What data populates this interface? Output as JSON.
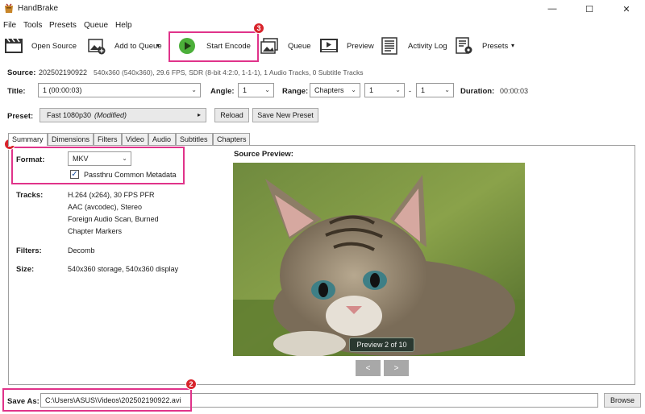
{
  "window": {
    "title": "HandBrake"
  },
  "menu": [
    "File",
    "Tools",
    "Presets",
    "Queue",
    "Help"
  ],
  "toolbar": {
    "open_source": "Open Source",
    "add_to_queue": "Add to Queue",
    "start_encode": "Start Encode",
    "queue": "Queue",
    "preview": "Preview",
    "activity_log": "Activity Log",
    "presets": "Presets"
  },
  "source": {
    "label": "Source:",
    "name": "202502190922",
    "details": "540x360 (540x360), 29.6 FPS, SDR (8-bit 4:2:0, 1-1-1), 1 Audio Tracks, 0 Subtitle Tracks"
  },
  "title_row": {
    "title_label": "Title:",
    "title_value": "1 (00:00:03)",
    "angle_label": "Angle:",
    "angle_value": "1",
    "range_label": "Range:",
    "range_type": "Chapters",
    "range_start": "1",
    "range_sep": "-",
    "range_end": "1",
    "duration_label": "Duration:",
    "duration_value": "00:00:03"
  },
  "preset_row": {
    "label": "Preset:",
    "value": "Fast 1080p30",
    "modified": "(Modified)",
    "reload": "Reload",
    "save_new": "Save New Preset"
  },
  "tabs": [
    "Summary",
    "Dimensions",
    "Filters",
    "Video",
    "Audio",
    "Subtitles",
    "Chapters"
  ],
  "summary": {
    "format_label": "Format:",
    "format_value": "MKV",
    "passthru_label": "Passthru Common Metadata",
    "passthru_checked": true,
    "tracks_label": "Tracks:",
    "tracks": [
      "H.264 (x264), 30 FPS PFR",
      "AAC (avcodec), Stereo",
      "Foreign Audio Scan, Burned",
      "Chapter Markers"
    ],
    "filters_label": "Filters:",
    "filters_value": "Decomb",
    "size_label": "Size:",
    "size_value": "540x360 storage, 540x360 display",
    "preview_label": "Source Preview:",
    "preview_caption": "Preview 2 of 10",
    "prev_button": "<",
    "next_button": ">"
  },
  "save": {
    "label": "Save As:",
    "path": "C:\\Users\\ASUS\\Videos\\202502190922.avi",
    "browse": "Browse"
  },
  "annotations": {
    "badge1": "1",
    "badge2": "2",
    "badge3": "3"
  },
  "colors": {
    "highlight": "#e0338a",
    "badge": "#d8242b",
    "play": "#4caf3a"
  }
}
